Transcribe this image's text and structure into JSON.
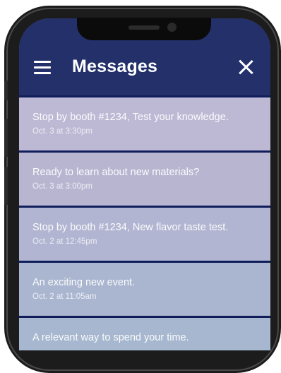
{
  "header": {
    "title": "Messages"
  },
  "messages": [
    {
      "text": "Stop by booth #1234, Test your knowledge.",
      "time": "Oct. 3 at 3:30pm",
      "bg": "#bdb8d4"
    },
    {
      "text": "Ready to learn about new materials?",
      "time": "Oct. 3 at 3:00pm",
      "bg": "#b8b5d1"
    },
    {
      "text": "Stop by booth #1234, New flavor taste test.",
      "time": "Oct. 2 at 12:45pm",
      "bg": "#b1b5d1"
    },
    {
      "text": "An exciting new event.",
      "time": "Oct. 2 at 11:05am",
      "bg": "#aab6d0"
    },
    {
      "text": "A relevant way to spend your time.",
      "time": "",
      "bg": "#a6b7cf"
    }
  ],
  "colors": {
    "header_bg": "#24306a",
    "divider": "#0f1e5a",
    "phone_frame": "#1c1c1c"
  },
  "icons": {
    "menu": "hamburger-menu-icon",
    "close": "close-icon"
  }
}
